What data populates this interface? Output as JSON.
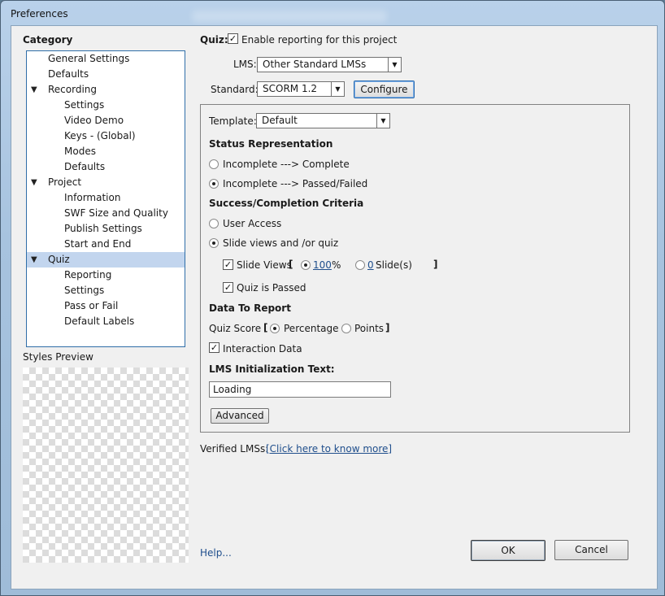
{
  "window": {
    "title": "Preferences"
  },
  "sidebar": {
    "heading": "Category",
    "items": [
      {
        "label": "General Settings"
      },
      {
        "label": "Defaults"
      },
      {
        "label": "Recording",
        "expandable": true
      },
      {
        "label": "Settings"
      },
      {
        "label": "Video Demo"
      },
      {
        "label": "Keys - (Global)"
      },
      {
        "label": "Modes"
      },
      {
        "label": "Defaults"
      },
      {
        "label": "Project",
        "expandable": true
      },
      {
        "label": "Information"
      },
      {
        "label": "SWF Size and Quality"
      },
      {
        "label": "Publish Settings"
      },
      {
        "label": "Start and End"
      },
      {
        "label": "Quiz",
        "expandable": true,
        "selected": true
      },
      {
        "label": "Reporting"
      },
      {
        "label": "Settings"
      },
      {
        "label": "Pass or Fail"
      },
      {
        "label": "Default Labels"
      }
    ],
    "styles_preview_label": "Styles Preview"
  },
  "quiz": {
    "label": "Quiz:",
    "enable_reporting": {
      "label": "Enable reporting for this project",
      "checked": true
    },
    "lms": {
      "label": "LMS:",
      "value": "Other Standard LMSs"
    },
    "standard": {
      "label": "Standard:",
      "value": "SCORM 1.2"
    },
    "configure_label": "Configure"
  },
  "panel": {
    "template": {
      "label": "Template:",
      "value": "Default"
    },
    "status_heading": "Status Representation",
    "status_options": [
      {
        "label": "Incomplete ---> Complete",
        "selected": false
      },
      {
        "label": "Incomplete ---> Passed/Failed",
        "selected": true
      }
    ],
    "criteria_heading": "Success/Completion Criteria",
    "criteria_options": [
      {
        "label": "User Access",
        "selected": false
      },
      {
        "label": "Slide views and /or quiz",
        "selected": true
      }
    ],
    "slide_views": {
      "label": "Slide Views",
      "bracket_open": "[",
      "bracket_close": "]",
      "percent_value": "100",
      "percent_unit": "%",
      "slides_value": "0",
      "slides_unit": "Slide(s)",
      "checked": true
    },
    "quiz_passed": {
      "label": "Quiz is Passed",
      "checked": true
    },
    "data_heading": "Data To Report",
    "quiz_score": {
      "label": "Quiz Score",
      "bracket_open": "[",
      "bracket_close": "]",
      "percentage_label": "Percentage",
      "points_label": "Points",
      "selected": "Percentage"
    },
    "interaction_data": {
      "label": "Interaction Data",
      "checked": true
    },
    "lms_init_heading": "LMS Initialization Text:",
    "lms_init_value": "Loading",
    "advanced_label": "Advanced"
  },
  "verified": {
    "label": "Verified LMSs:",
    "link_label": "[Click here to know more]"
  },
  "footer": {
    "help_label": "Help...",
    "ok_label": "OK",
    "cancel_label": "Cancel"
  },
  "colors": {
    "selection": "#c2d5ee",
    "tree_border": "#2f6ea8",
    "link": "#1f4e8c"
  }
}
